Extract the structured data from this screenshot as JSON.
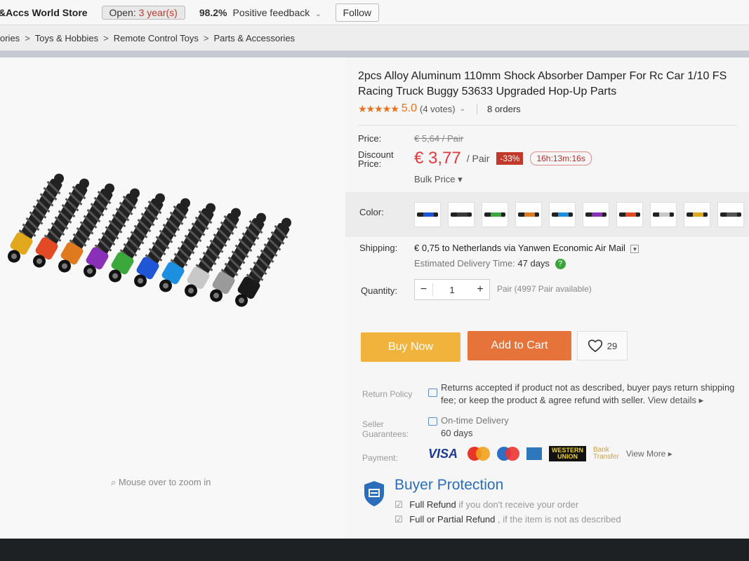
{
  "store": {
    "name": "&Accs World Store",
    "open_label": "Open:",
    "open_years": "3 year(s)",
    "feedback_pct": "98.2%",
    "feedback_label": "Positive feedback",
    "follow_label": "Follow"
  },
  "breadcrumb": [
    "ories",
    "Toys & Hobbies",
    "Remote Control Toys",
    "Parts & Accessories"
  ],
  "image": {
    "zoom_hint": "Mouse over to zoom in",
    "shock_colors": [
      "#e0a81a",
      "#e24a25",
      "#e07a1e",
      "#8a2fb8",
      "#3aa83a",
      "#1f56d6",
      "#1d8fe0",
      "#c8c8c8",
      "#9a9a9a",
      "#1a1a1a"
    ]
  },
  "product": {
    "title": "2pcs Alloy Aluminum 110mm Shock Absorber Damper For Rc Car 1/10 FS Racing Truck Buggy 53633 Upgraded Hop-Up Parts",
    "stars": "★★★★★",
    "rating": "5.0",
    "votes": "(4 votes)",
    "orders": "8 orders",
    "price_label": "Price:",
    "old_price": "€ 5,64 / Pair",
    "discount_label_1": "Discount",
    "discount_label_2": "Price:",
    "price": "€ 3,77",
    "price_unit": "/ Pair",
    "discount_pct": "-33%",
    "countdown": "16h:13m:16s",
    "bulk_price": "Bulk Price ▾",
    "color_label": "Color:",
    "swatch_colors": [
      "#1f56d6",
      "#3a3a3a",
      "#3aa83a",
      "#e07a1e",
      "#1d8fe0",
      "#8a2fb8",
      "#e24a25",
      "#c8c8c8",
      "#e0a81a",
      "#555555"
    ],
    "shipping_label": "Shipping:",
    "shipping_text": "€ 0,75 to Netherlands via Yanwen Economic Air Mail",
    "delivery_label": "Estimated Delivery Time:",
    "delivery_days": "47 days",
    "quantity_label": "Quantity:",
    "quantity": "1",
    "quantity_available": "Pair (4997 Pair available)",
    "buy_now": "Buy Now",
    "add_to_cart": "Add to Cart",
    "wishlist_count": "29"
  },
  "policy": {
    "return_label": "Return Policy",
    "return_text_1": "Returns accepted if product not as described, buyer pays return shipping",
    "return_text_2": "fee; or keep the product & agree refund with seller.",
    "view_details": "View details ▸",
    "guarantee_label_1": "Seller",
    "guarantee_label_2": "Guarantees:",
    "guarantee_text": "On-time Delivery",
    "guarantee_days": "60 days",
    "payment_label": "Payment:",
    "visa": "VISA",
    "western_union_1": "WESTERN",
    "western_union_2": "UNION",
    "bank_1": "Bank",
    "bank_2": "Transfer",
    "view_more": "View More ▸"
  },
  "buyer_protection": {
    "title": "Buyer Protection",
    "line1_bold": "Full Refund",
    "line1_rest": "if you don't receive your order",
    "line2_bold": "Full or Partial Refund",
    "line2_rest": ", if the item is not as described"
  }
}
